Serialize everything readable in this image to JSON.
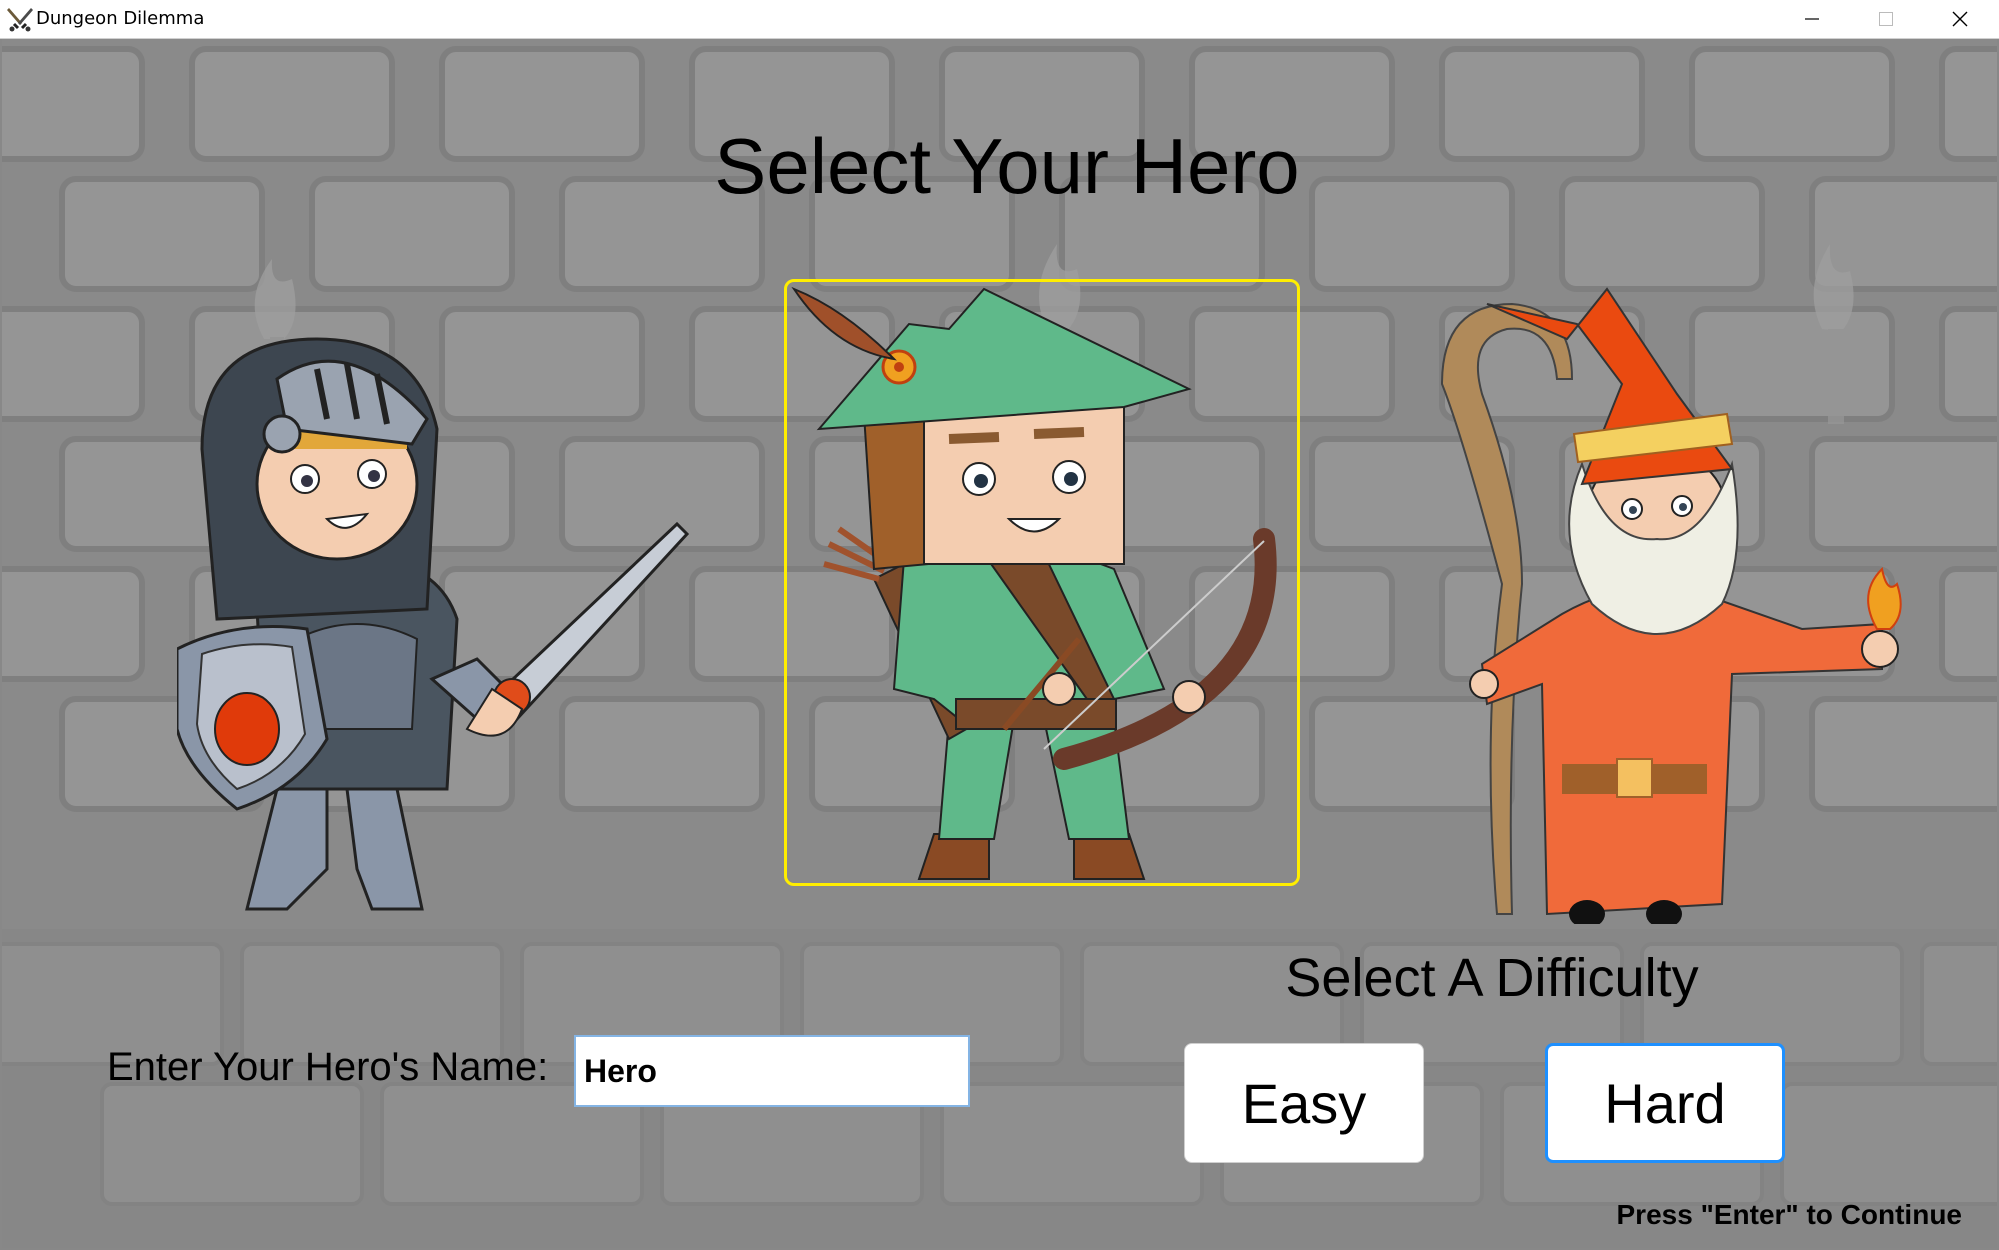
{
  "window": {
    "title": "Dungeon Dilemma",
    "icon": "crossed-swords-icon"
  },
  "screen": {
    "heading": "Select Your Hero",
    "heroes": [
      {
        "name": "knight",
        "selected": false
      },
      {
        "name": "archer",
        "selected": true
      },
      {
        "name": "wizard",
        "selected": false
      }
    ],
    "name_label": "Enter Your Hero's Name:",
    "name_value": "Hero",
    "difficulty_label": "Select A Difficulty",
    "difficulty_options": [
      "Easy",
      "Hard"
    ],
    "difficulty_focused": "Hard",
    "continue_hint": "Press \"Enter\" to Continue",
    "colors": {
      "selection_frame": "#ffee00",
      "focus_border": "#1e90ff",
      "background": "#8c8c8c"
    }
  }
}
